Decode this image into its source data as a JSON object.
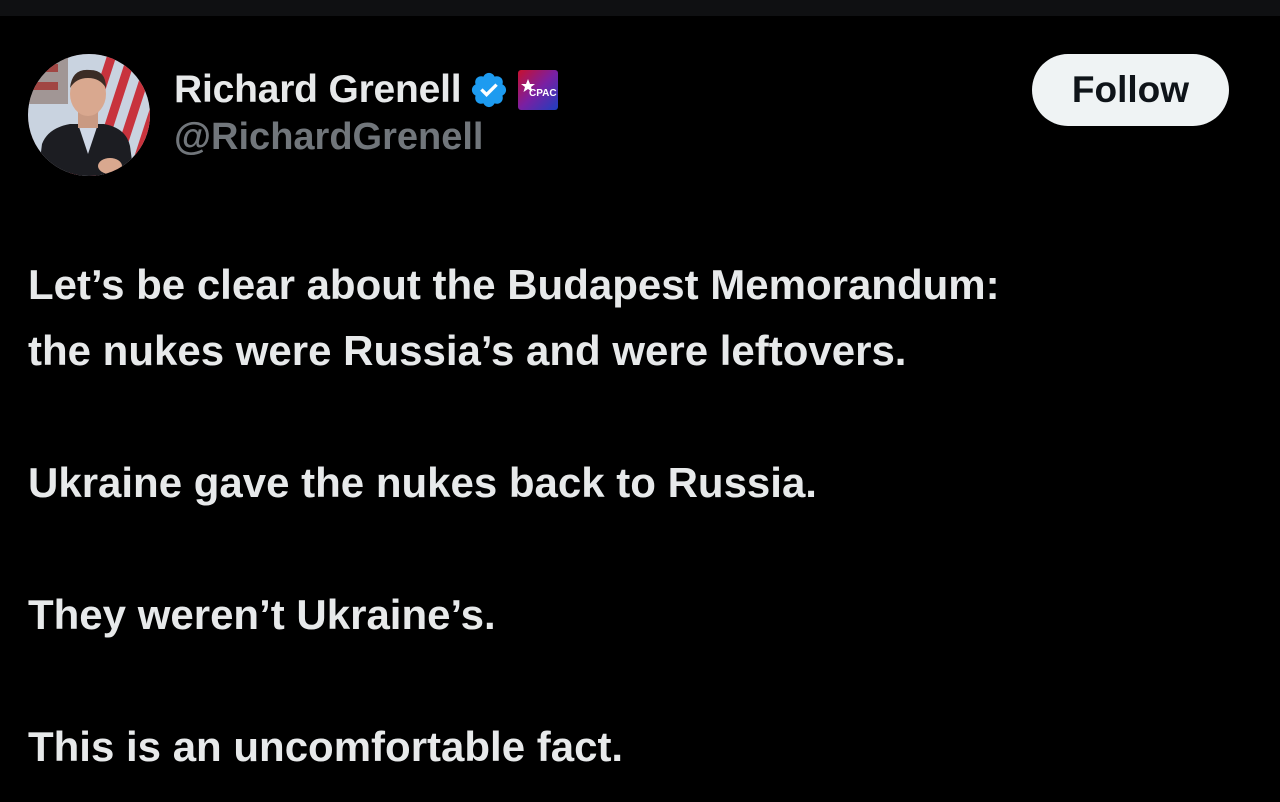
{
  "author": {
    "display_name": "Richard Grenell",
    "handle": "@RichardGrenell",
    "avatar_icon": "profile-photo",
    "verified_icon": "verified-badge-icon",
    "verified_color": "#1d9bf0",
    "affiliate_icon": "cpac-affiliate-badge",
    "affiliate_text": "CPAC"
  },
  "actions": {
    "follow_label": "Follow"
  },
  "tweet": {
    "paragraphs": [
      [
        "Let’s be clear about the Budapest Memorandum:",
        "the nukes were Russia’s and were leftovers."
      ],
      [
        "Ukraine gave the nukes back to Russia."
      ],
      [
        "They weren’t Ukraine’s."
      ],
      [
        "This is an uncomfortable fact."
      ]
    ]
  },
  "colors": {
    "background": "#000000",
    "text_primary": "#e7e9ea",
    "text_secondary": "#71767b",
    "button_bg": "#eff3f4"
  }
}
